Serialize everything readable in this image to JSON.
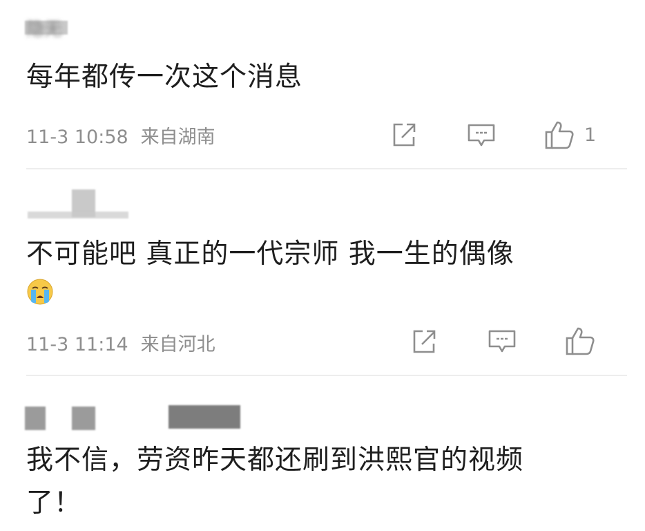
{
  "comments": [
    {
      "username": "隐无",
      "text": "每年都传一次这个消息",
      "time": "11-3 10:58",
      "location": "来自湖南",
      "likes": "1"
    },
    {
      "username": "",
      "text": "不可能吧  真正的一代宗师  我一生的偶像",
      "emoji": "crying-face",
      "time": "11-3 11:14",
      "location": "来自河北",
      "likes": ""
    },
    {
      "username": "",
      "text_line1": "我不信，劳资昨天都还刷到洪熙官的视频",
      "text_line2": "了！"
    }
  ],
  "icons": {
    "share": "share-icon",
    "comment": "comment-icon",
    "like": "thumbs-up-icon"
  },
  "colors": {
    "text": "#1e1e1e",
    "meta": "#8e8e8e",
    "divider": "#ededed"
  }
}
